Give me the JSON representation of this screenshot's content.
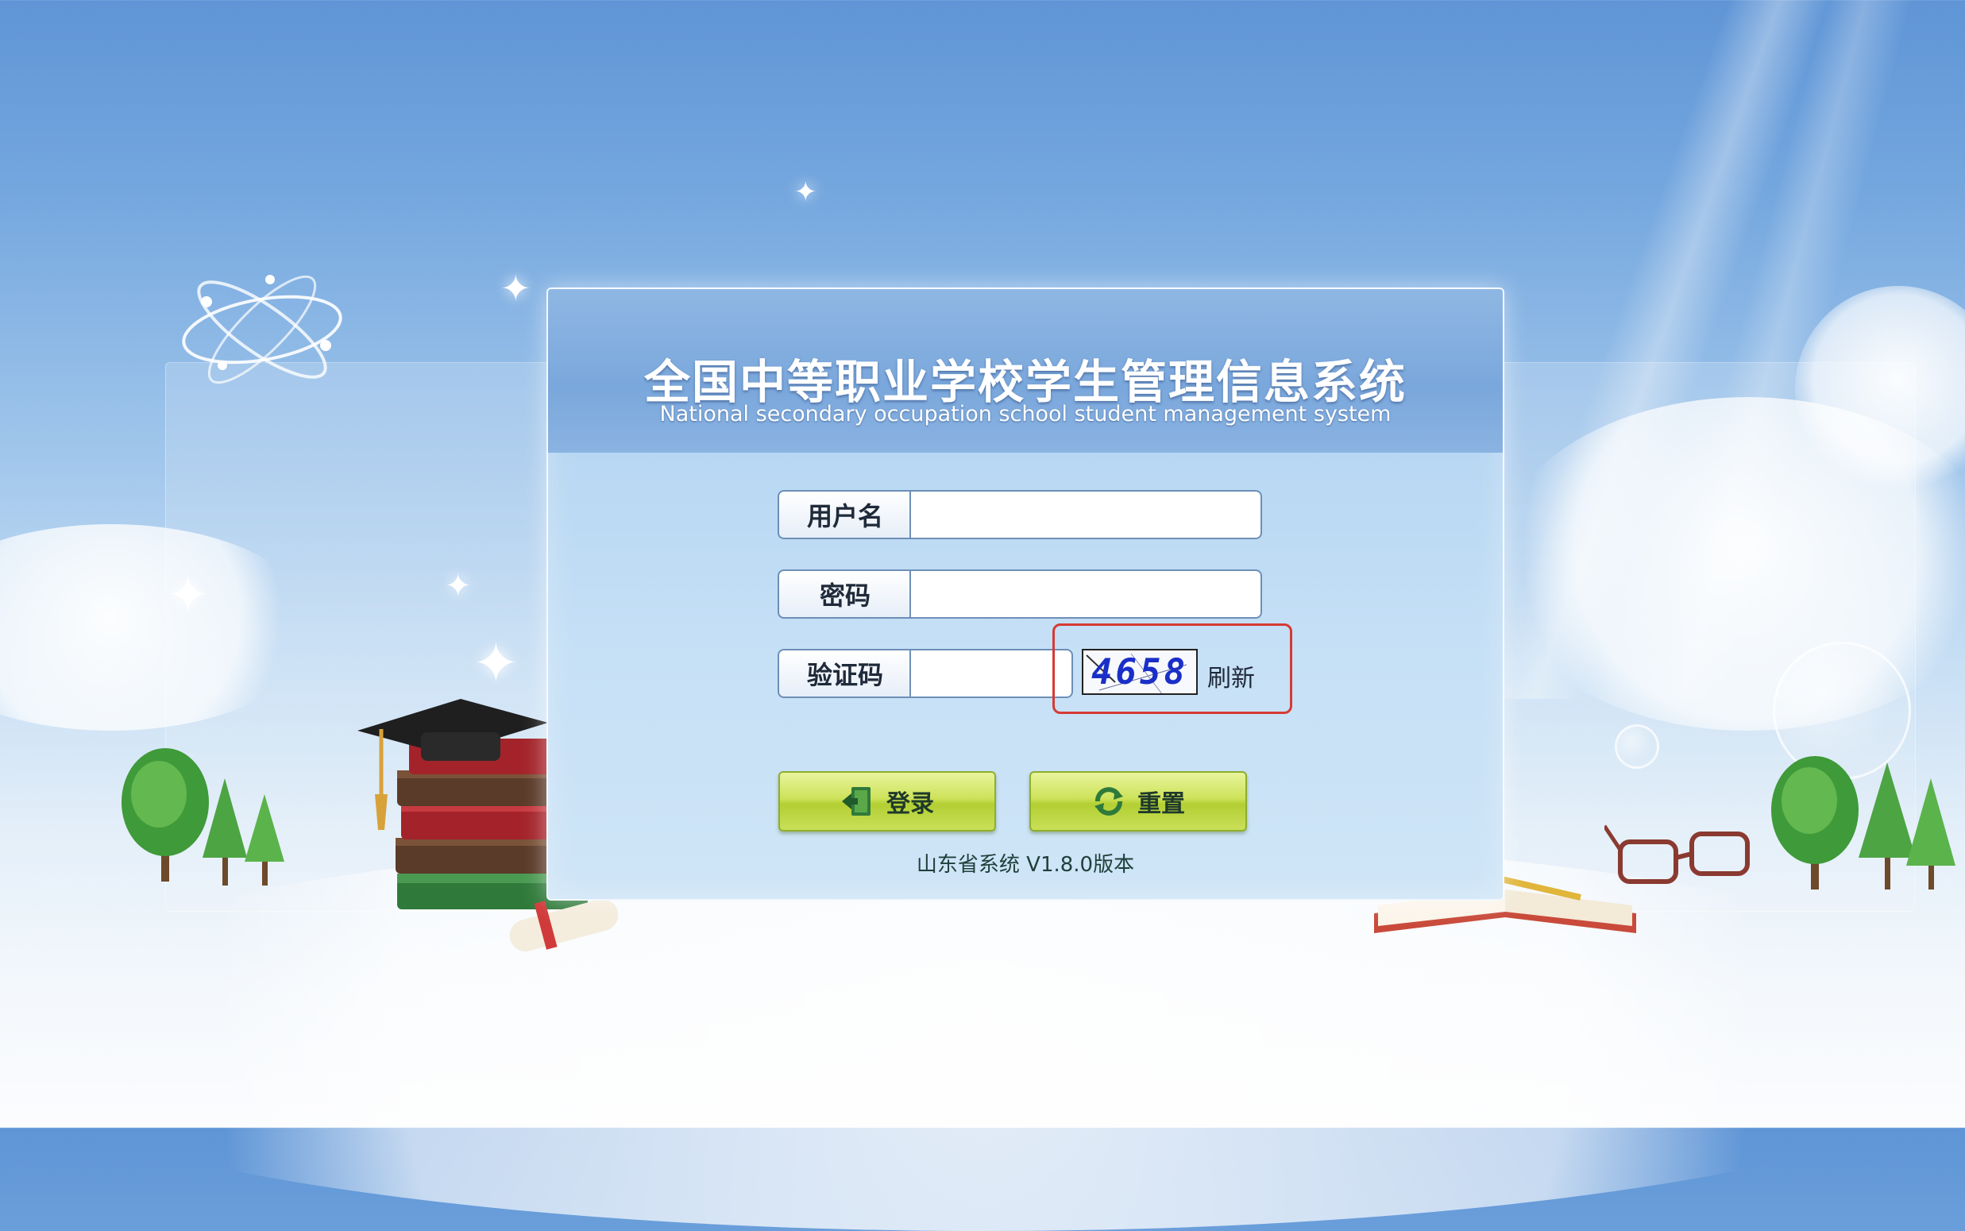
{
  "header": {
    "title": "全国中等职业学校学生管理信息系统",
    "subtitle": "National secondary occupation school student management system"
  },
  "form": {
    "username_label": "用户名",
    "username_value": "",
    "password_label": "密码",
    "password_value": "",
    "captcha_label": "验证码",
    "captcha_value": "",
    "captcha_image_text": "4658",
    "refresh_label": "刷新"
  },
  "buttons": {
    "login_label": "登录",
    "reset_label": "重置",
    "login_icon": "door-exit-icon",
    "reset_icon": "refresh-arrows-icon"
  },
  "footer": {
    "version": "山东省系统 V1.8.0版本"
  },
  "colors": {
    "highlight_box": "#d63a34",
    "button_green": "#c5dd4f",
    "captcha_text": "#1a2fc8"
  }
}
